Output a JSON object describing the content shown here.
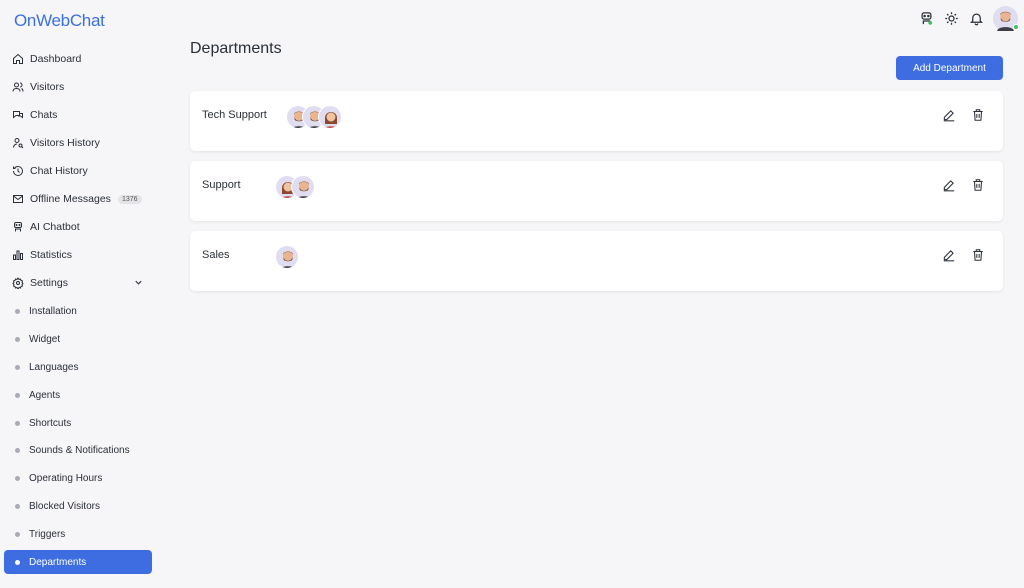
{
  "app": {
    "logo_text": "OnWebChat"
  },
  "sidebar": {
    "items": [
      {
        "label": "Dashboard",
        "icon": "home-icon"
      },
      {
        "label": "Visitors",
        "icon": "users-icon"
      },
      {
        "label": "Chats",
        "icon": "chats-icon"
      },
      {
        "label": "Visitors History",
        "icon": "user-search-icon"
      },
      {
        "label": "Chat History",
        "icon": "history-icon"
      },
      {
        "label": "Offline Messages",
        "icon": "mail-icon",
        "badge": "1376"
      },
      {
        "label": "AI Chatbot",
        "icon": "robot-icon"
      },
      {
        "label": "Statistics",
        "icon": "bar-chart-icon"
      },
      {
        "label": "Settings",
        "icon": "gear-icon"
      }
    ],
    "settings_sub": [
      {
        "label": "Installation"
      },
      {
        "label": "Widget"
      },
      {
        "label": "Languages"
      },
      {
        "label": "Agents"
      },
      {
        "label": "Shortcuts"
      },
      {
        "label": "Sounds & Notifications"
      },
      {
        "label": "Operating Hours"
      },
      {
        "label": "Blocked Visitors"
      },
      {
        "label": "Triggers"
      },
      {
        "label": "Departments",
        "active": true
      }
    ]
  },
  "main": {
    "title": "Departments",
    "add_button": "Add Department",
    "departments": [
      {
        "name": "Tech Support",
        "agents": [
          "male",
          "male",
          "female"
        ]
      },
      {
        "name": "Support",
        "agents": [
          "female",
          "male"
        ]
      },
      {
        "name": "Sales",
        "agents": [
          "male"
        ]
      }
    ]
  },
  "colors": {
    "accent": "#3d6de0",
    "online": "#3fbf60"
  }
}
